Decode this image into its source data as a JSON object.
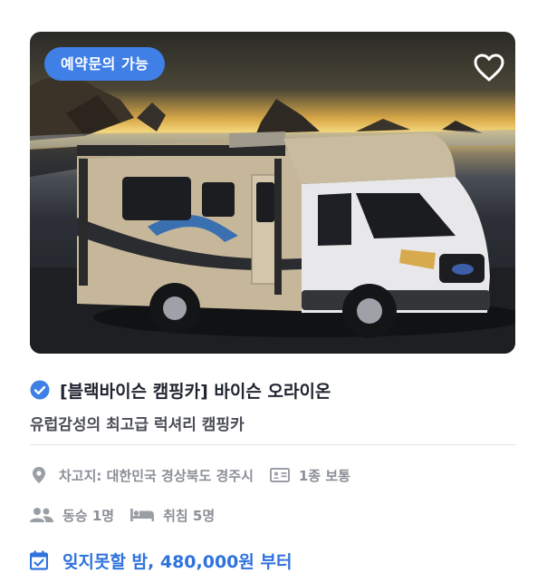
{
  "listing": {
    "badge": "예약문의 가능",
    "title": "[블랙바이슨 캠핑카] 바이슨 오라이온",
    "subtitle": "유럽감성의 최고급 럭셔리 캠핑카",
    "location": "차고지: 대한민국 경상북도 경주시",
    "license": "1종 보통",
    "passengers": "동승 1명",
    "sleeps": "취침 5명",
    "price": "잊지못할 밤, 480,000원 부터"
  },
  "icons": {
    "favorite": "heart-outline-icon",
    "verified": "check-circle-icon",
    "location": "map-pin-icon",
    "license": "id-card-icon",
    "passengers": "users-icon",
    "sleeps": "bed-icon",
    "price": "calendar-check-icon"
  },
  "colors": {
    "accent": "#3f7fe6",
    "price_text": "#2f72dd",
    "meta_text": "#8b8f96",
    "title_text": "#1f2430"
  }
}
